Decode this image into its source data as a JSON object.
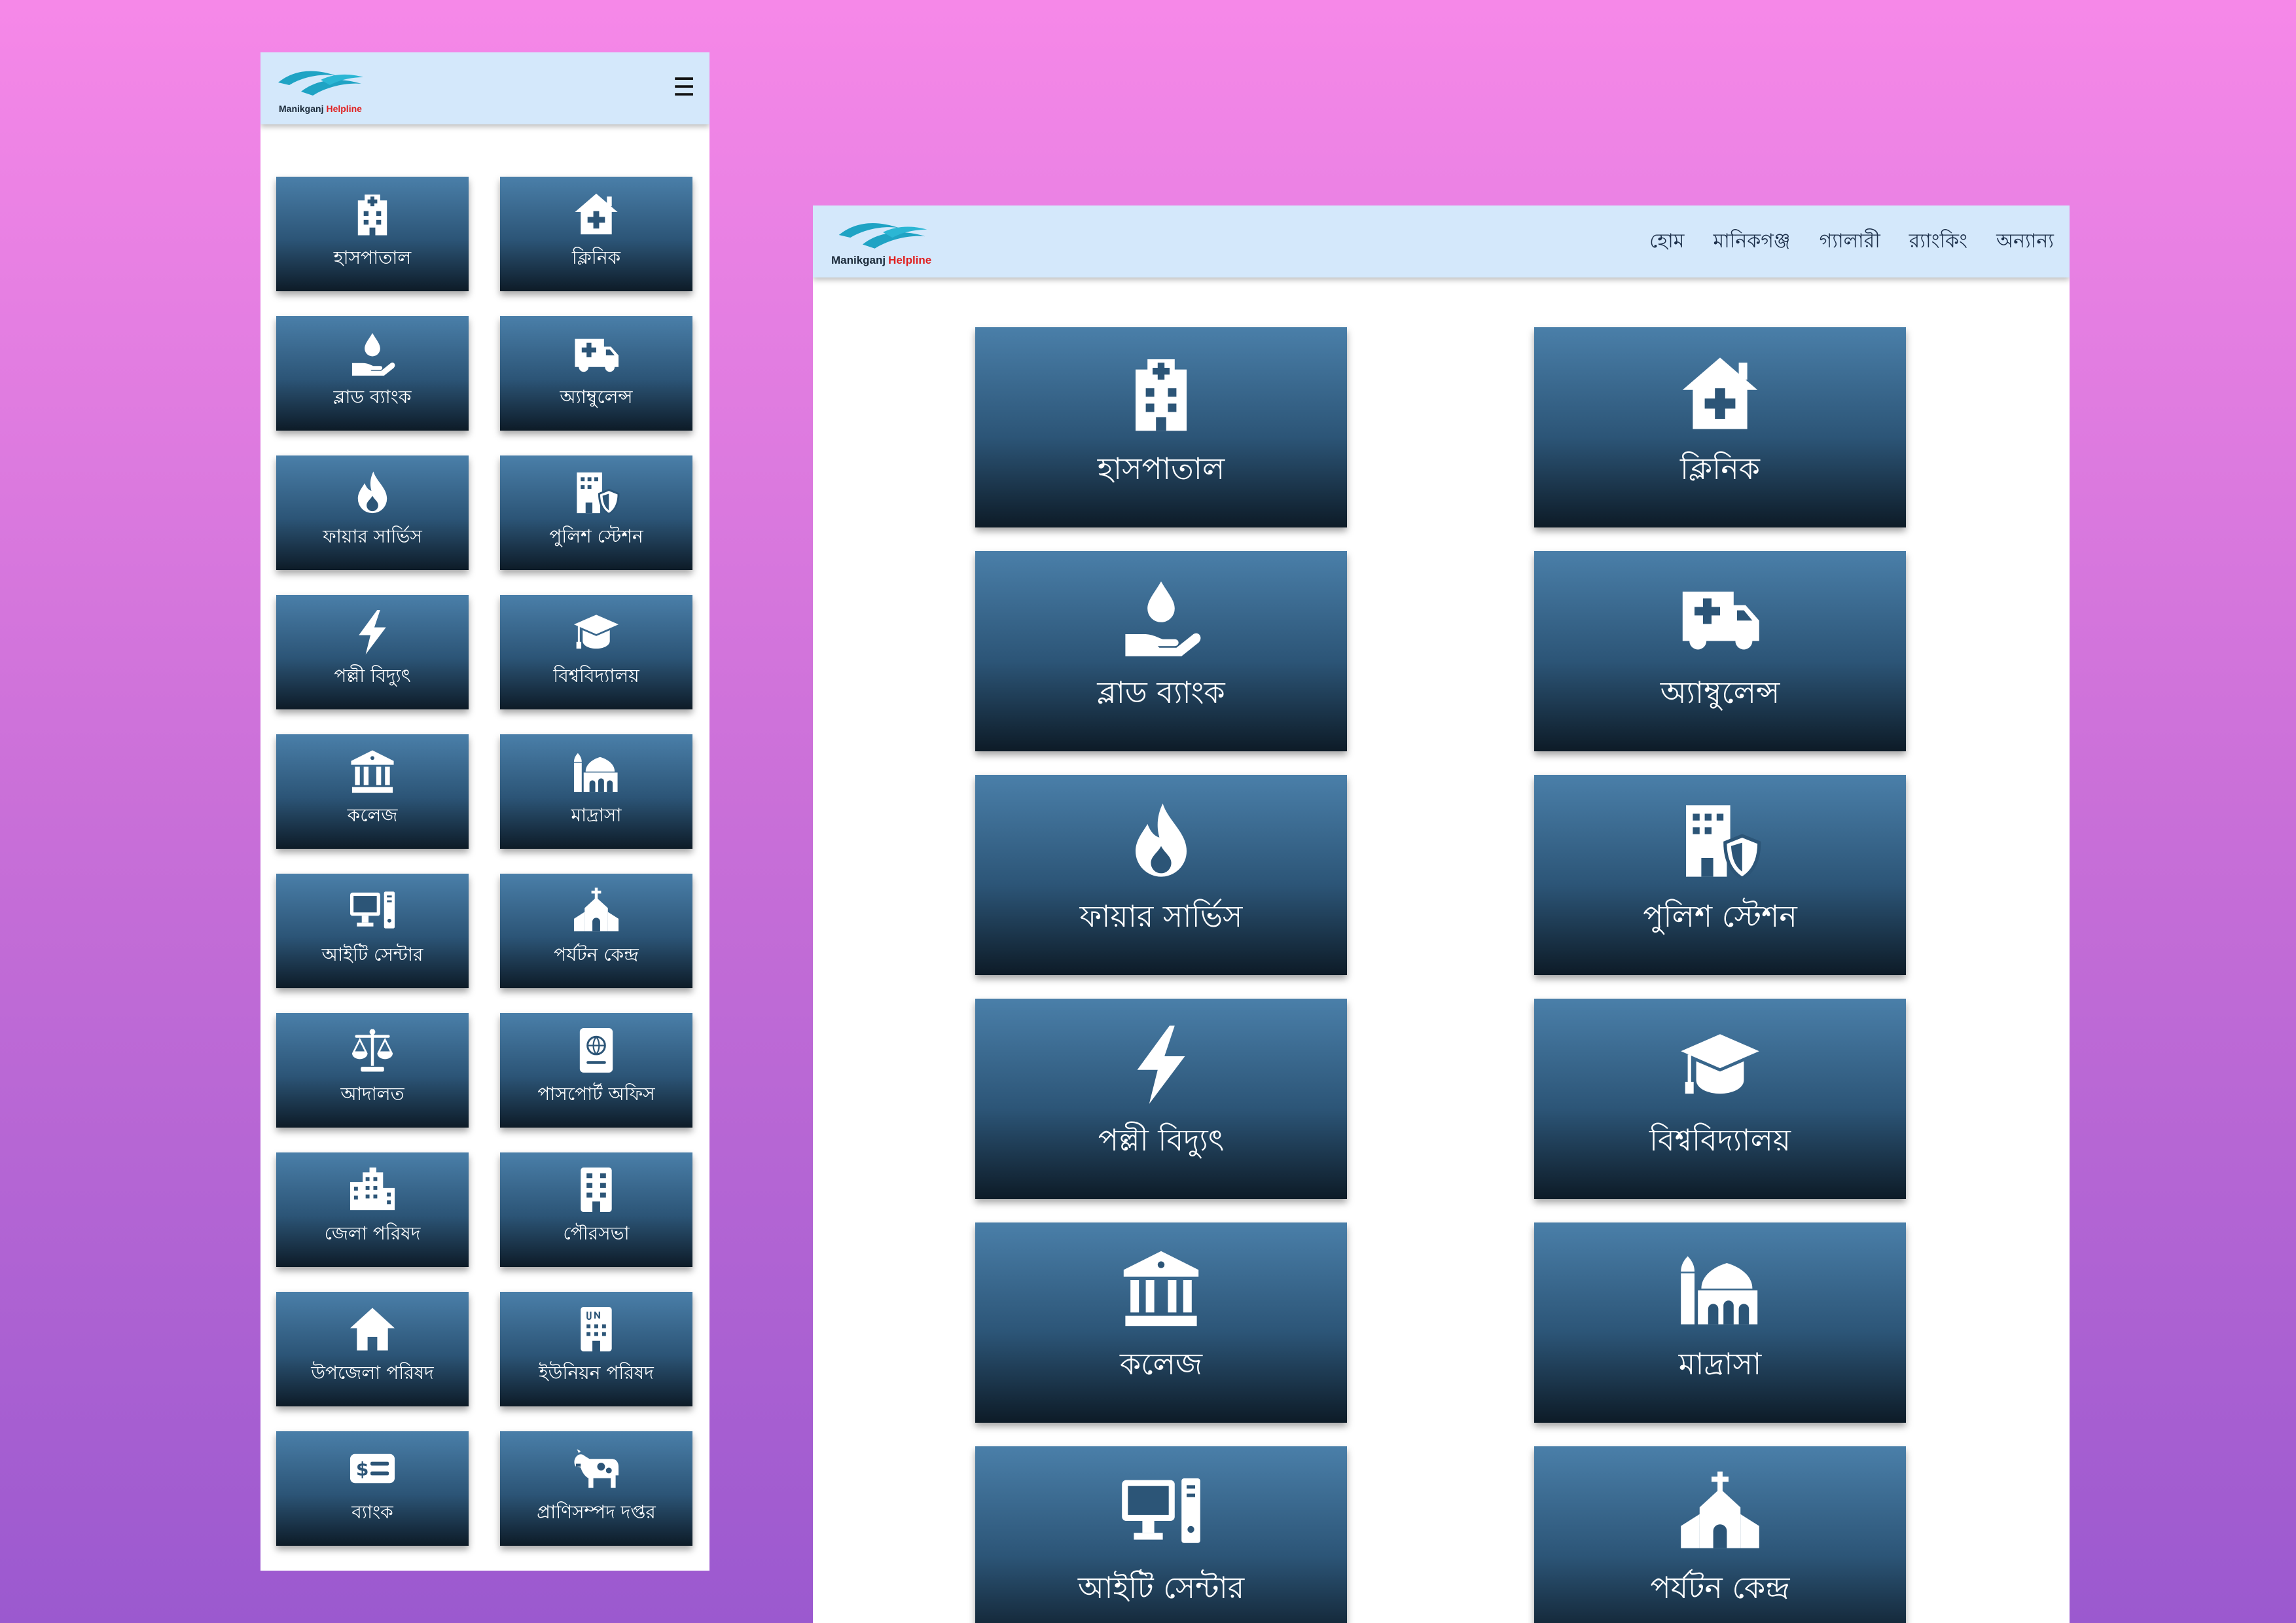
{
  "brand": {
    "name": "Manikganj",
    "accent": "Helpline"
  },
  "mobile": {
    "menu_icon": "☰"
  },
  "nav": [
    "হোম",
    "মানিকগঞ্জ",
    "গ্যালারী",
    "র‍্যাংকিং",
    "অন্যান্য"
  ],
  "services": [
    {
      "label": "হাসপাতাল",
      "icon": "hospital-icon"
    },
    {
      "label": "ক্লিনিক",
      "icon": "house-medical-icon"
    },
    {
      "label": "ব্লাড ব্যাংক",
      "icon": "hand-holding-droplet-icon"
    },
    {
      "label": "অ্যাম্বুলেন্স",
      "icon": "truck-medical-icon"
    },
    {
      "label": "ফায়ার সার্ভিস",
      "icon": "fire-icon"
    },
    {
      "label": "পুলিশ স্টেশন",
      "icon": "building-shield-icon"
    },
    {
      "label": "পল্লী বিদ্যুৎ",
      "icon": "bolt-icon"
    },
    {
      "label": "বিশ্ববিদ্যালয়",
      "icon": "graduation-cap-icon"
    },
    {
      "label": "কলেজ",
      "icon": "building-columns-icon"
    },
    {
      "label": "মাদ্রাসা",
      "icon": "mosque-icon"
    },
    {
      "label": "আইটি সেন্টার",
      "icon": "computer-icon"
    },
    {
      "label": "পর্যটন কেন্দ্র",
      "icon": "church-icon"
    },
    {
      "label": "আদালত",
      "icon": "scale-balanced-icon"
    },
    {
      "label": "পাসপোর্ট অফিস",
      "icon": "passport-icon"
    },
    {
      "label": "জেলা পরিষদ",
      "icon": "city-icon"
    },
    {
      "label": "পৌরসভা",
      "icon": "building-icon"
    },
    {
      "label": "উপজেলা পরিষদ",
      "icon": "house-icon"
    },
    {
      "label": "ইউনিয়ন পরিষদ",
      "icon": "building-un-icon"
    },
    {
      "label": "ব্যাংক",
      "icon": "money-bill-icon"
    },
    {
      "label": "প্রাণিসম্পদ দপ্তর",
      "icon": "cow-icon"
    }
  ],
  "desktop_visible_count": 12,
  "colors": {
    "background_top": "#f688e8",
    "background_bottom": "#9b59cf",
    "header": "#d4e8fb",
    "tile_top": "#4a7fa9",
    "tile_bottom": "#0d1b27",
    "brand_teal": "#1fa3c4",
    "brand_accent": "#e02020"
  }
}
